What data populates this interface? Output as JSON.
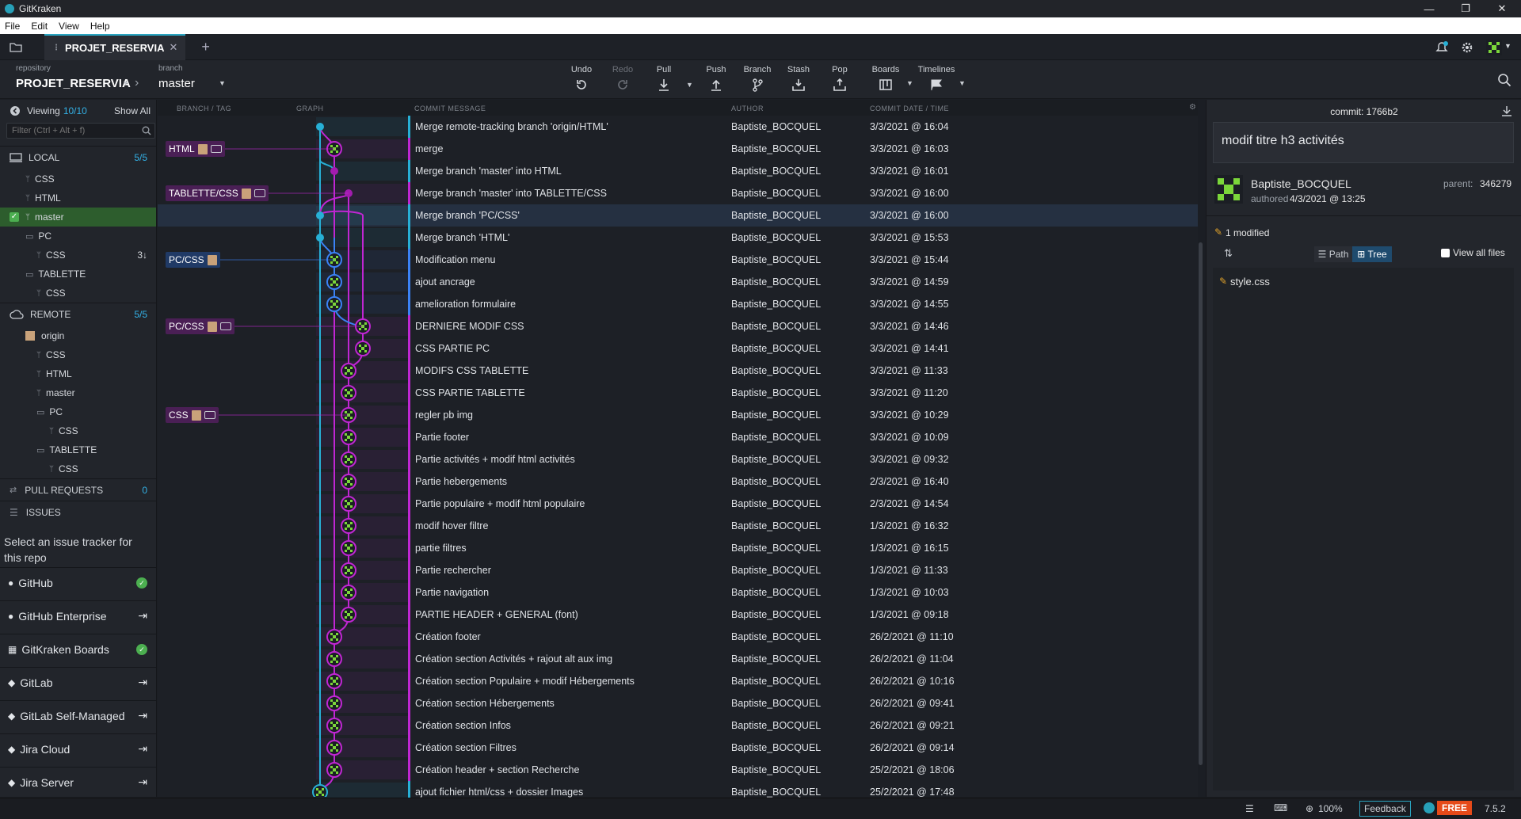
{
  "titlebar": {
    "app": "GitKraken",
    "min": "—",
    "max": "❐",
    "close": "✕"
  },
  "menu": [
    "File",
    "Edit",
    "View",
    "Help"
  ],
  "tab": {
    "name": "PROJET_RESERVIA",
    "close": "✕",
    "add": "+"
  },
  "toolbar": {
    "repo_label": "repository",
    "repo": "PROJET_RESERVIA",
    "branch_label": "branch",
    "branch": "master",
    "buttons": [
      "Undo",
      "Redo",
      "Pull",
      "Push",
      "Branch",
      "Stash",
      "Pop",
      "Boards",
      "Timelines"
    ]
  },
  "sidebar": {
    "viewing": "Viewing",
    "viewing_count": "10/10",
    "show_all": "Show All",
    "filter_placeholder": "Filter (Ctrl + Alt + f)",
    "local": {
      "label": "LOCAL",
      "count": "5/5"
    },
    "local_items": [
      "CSS",
      "HTML",
      "master",
      "PC",
      "CSS",
      "TABLETTE",
      "CSS"
    ],
    "behind": "3↓",
    "remote": {
      "label": "REMOTE",
      "count": "5/5"
    },
    "remote_items": [
      "origin",
      "CSS",
      "HTML",
      "master",
      "PC",
      "CSS",
      "TABLETTE",
      "CSS"
    ],
    "pull_requests": {
      "label": "PULL REQUESTS",
      "count": "0"
    },
    "issues": "ISSUES",
    "issue_hint": "Select an issue tracker for this repo",
    "integrations": [
      "GitHub",
      "GitHub Enterprise",
      "GitKraken Boards",
      "GitLab",
      "GitLab Self-Managed",
      "Jira Cloud",
      "Jira Server"
    ]
  },
  "columns": {
    "branch": "BRANCH / TAG",
    "graph": "GRAPH",
    "message": "COMMIT MESSAGE",
    "author": "AUTHOR",
    "date": "COMMIT DATE / TIME"
  },
  "tags": [
    "HTML",
    "TABLETTE/CSS",
    "PC/CSS",
    "PC/CSS",
    "CSS"
  ],
  "commits": [
    {
      "msg": "Merge remote-tracking branch 'origin/HTML'",
      "author": "Baptiste_BOCQUEL",
      "date": "3/3/2021 @ 16:04"
    },
    {
      "msg": "merge",
      "author": "Baptiste_BOCQUEL",
      "date": "3/3/2021 @ 16:03"
    },
    {
      "msg": "Merge branch 'master' into HTML",
      "author": "Baptiste_BOCQUEL",
      "date": "3/3/2021 @ 16:01"
    },
    {
      "msg": "Merge branch 'master' into TABLETTE/CSS",
      "author": "Baptiste_BOCQUEL",
      "date": "3/3/2021 @ 16:00"
    },
    {
      "msg": "Merge branch 'PC/CSS'",
      "author": "Baptiste_BOCQUEL",
      "date": "3/3/2021 @ 16:00"
    },
    {
      "msg": "Merge branch 'HTML'",
      "author": "Baptiste_BOCQUEL",
      "date": "3/3/2021 @ 15:53"
    },
    {
      "msg": "Modification menu",
      "author": "Baptiste_BOCQUEL",
      "date": "3/3/2021 @ 15:44"
    },
    {
      "msg": "ajout ancrage",
      "author": "Baptiste_BOCQUEL",
      "date": "3/3/2021 @ 14:59"
    },
    {
      "msg": "amelioration formulaire",
      "author": "Baptiste_BOCQUEL",
      "date": "3/3/2021 @ 14:55"
    },
    {
      "msg": "DERNIERE MODIF CSS",
      "author": "Baptiste_BOCQUEL",
      "date": "3/3/2021 @ 14:46"
    },
    {
      "msg": "CSS PARTIE PC",
      "author": "Baptiste_BOCQUEL",
      "date": "3/3/2021 @ 14:41"
    },
    {
      "msg": "MODIFS CSS TABLETTE",
      "author": "Baptiste_BOCQUEL",
      "date": "3/3/2021 @ 11:33"
    },
    {
      "msg": "CSS PARTIE TABLETTE",
      "author": "Baptiste_BOCQUEL",
      "date": "3/3/2021 @ 11:20"
    },
    {
      "msg": "regler pb img",
      "author": "Baptiste_BOCQUEL",
      "date": "3/3/2021 @ 10:29"
    },
    {
      "msg": "Partie footer",
      "author": "Baptiste_BOCQUEL",
      "date": "3/3/2021 @ 10:09"
    },
    {
      "msg": "Partie activités + modif html activités",
      "author": "Baptiste_BOCQUEL",
      "date": "3/3/2021 @ 09:32"
    },
    {
      "msg": "Partie hebergements",
      "author": "Baptiste_BOCQUEL",
      "date": "2/3/2021 @ 16:40"
    },
    {
      "msg": "Partie populaire + modif html populaire",
      "author": "Baptiste_BOCQUEL",
      "date": "2/3/2021 @ 14:54"
    },
    {
      "msg": "modif hover filtre",
      "author": "Baptiste_BOCQUEL",
      "date": "1/3/2021 @ 16:32"
    },
    {
      "msg": "partie filtres",
      "author": "Baptiste_BOCQUEL",
      "date": "1/3/2021 @ 16:15"
    },
    {
      "msg": "Partie rechercher",
      "author": "Baptiste_BOCQUEL",
      "date": "1/3/2021 @ 11:33"
    },
    {
      "msg": "Partie navigation",
      "author": "Baptiste_BOCQUEL",
      "date": "1/3/2021 @ 10:03"
    },
    {
      "msg": "PARTIE HEADER + GENERAL (font)",
      "author": "Baptiste_BOCQUEL",
      "date": "1/3/2021 @ 09:18"
    },
    {
      "msg": "Création footer",
      "author": "Baptiste_BOCQUEL",
      "date": "26/2/2021 @ 11:10"
    },
    {
      "msg": "Création section Activités + rajout alt aux img",
      "author": "Baptiste_BOCQUEL",
      "date": "26/2/2021 @ 11:04"
    },
    {
      "msg": "Création section Populaire + modif Hébergements",
      "author": "Baptiste_BOCQUEL",
      "date": "26/2/2021 @ 10:16"
    },
    {
      "msg": "Création section Hébergements",
      "author": "Baptiste_BOCQUEL",
      "date": "26/2/2021 @ 09:41"
    },
    {
      "msg": "Création section Infos",
      "author": "Baptiste_BOCQUEL",
      "date": "26/2/2021 @ 09:21"
    },
    {
      "msg": "Création section Filtres",
      "author": "Baptiste_BOCQUEL",
      "date": "26/2/2021 @ 09:14"
    },
    {
      "msg": "Création header + section Recherche",
      "author": "Baptiste_BOCQUEL",
      "date": "25/2/2021 @ 18:06"
    },
    {
      "msg": "ajout fichier html/css + dossier Images",
      "author": "Baptiste_BOCQUEL",
      "date": "25/2/2021 @ 17:48"
    }
  ],
  "detail": {
    "commit_label": "commit:",
    "commit_id": "1766b2",
    "summary": "modif titre h3 activités",
    "author": "Baptiste_BOCQUEL",
    "authored_label": "authored",
    "authored": "4/3/2021 @ 13:25",
    "parent_label": "parent:",
    "parent": "346279",
    "modified": "1 modified",
    "path": "Path",
    "tree": "Tree",
    "view_all": "View all files",
    "file": "style.css"
  },
  "statusbar": {
    "zoom": "100%",
    "feedback": "Feedback",
    "plan": "FREE",
    "version": "7.5.2"
  },
  "colors": {
    "accent": "#2aa4c0",
    "cyan": "#27b0d6",
    "magenta": "#c026d3",
    "blue": "#3b82f6",
    "master_bg": "#2d5d2d",
    "selected": "#253041"
  }
}
